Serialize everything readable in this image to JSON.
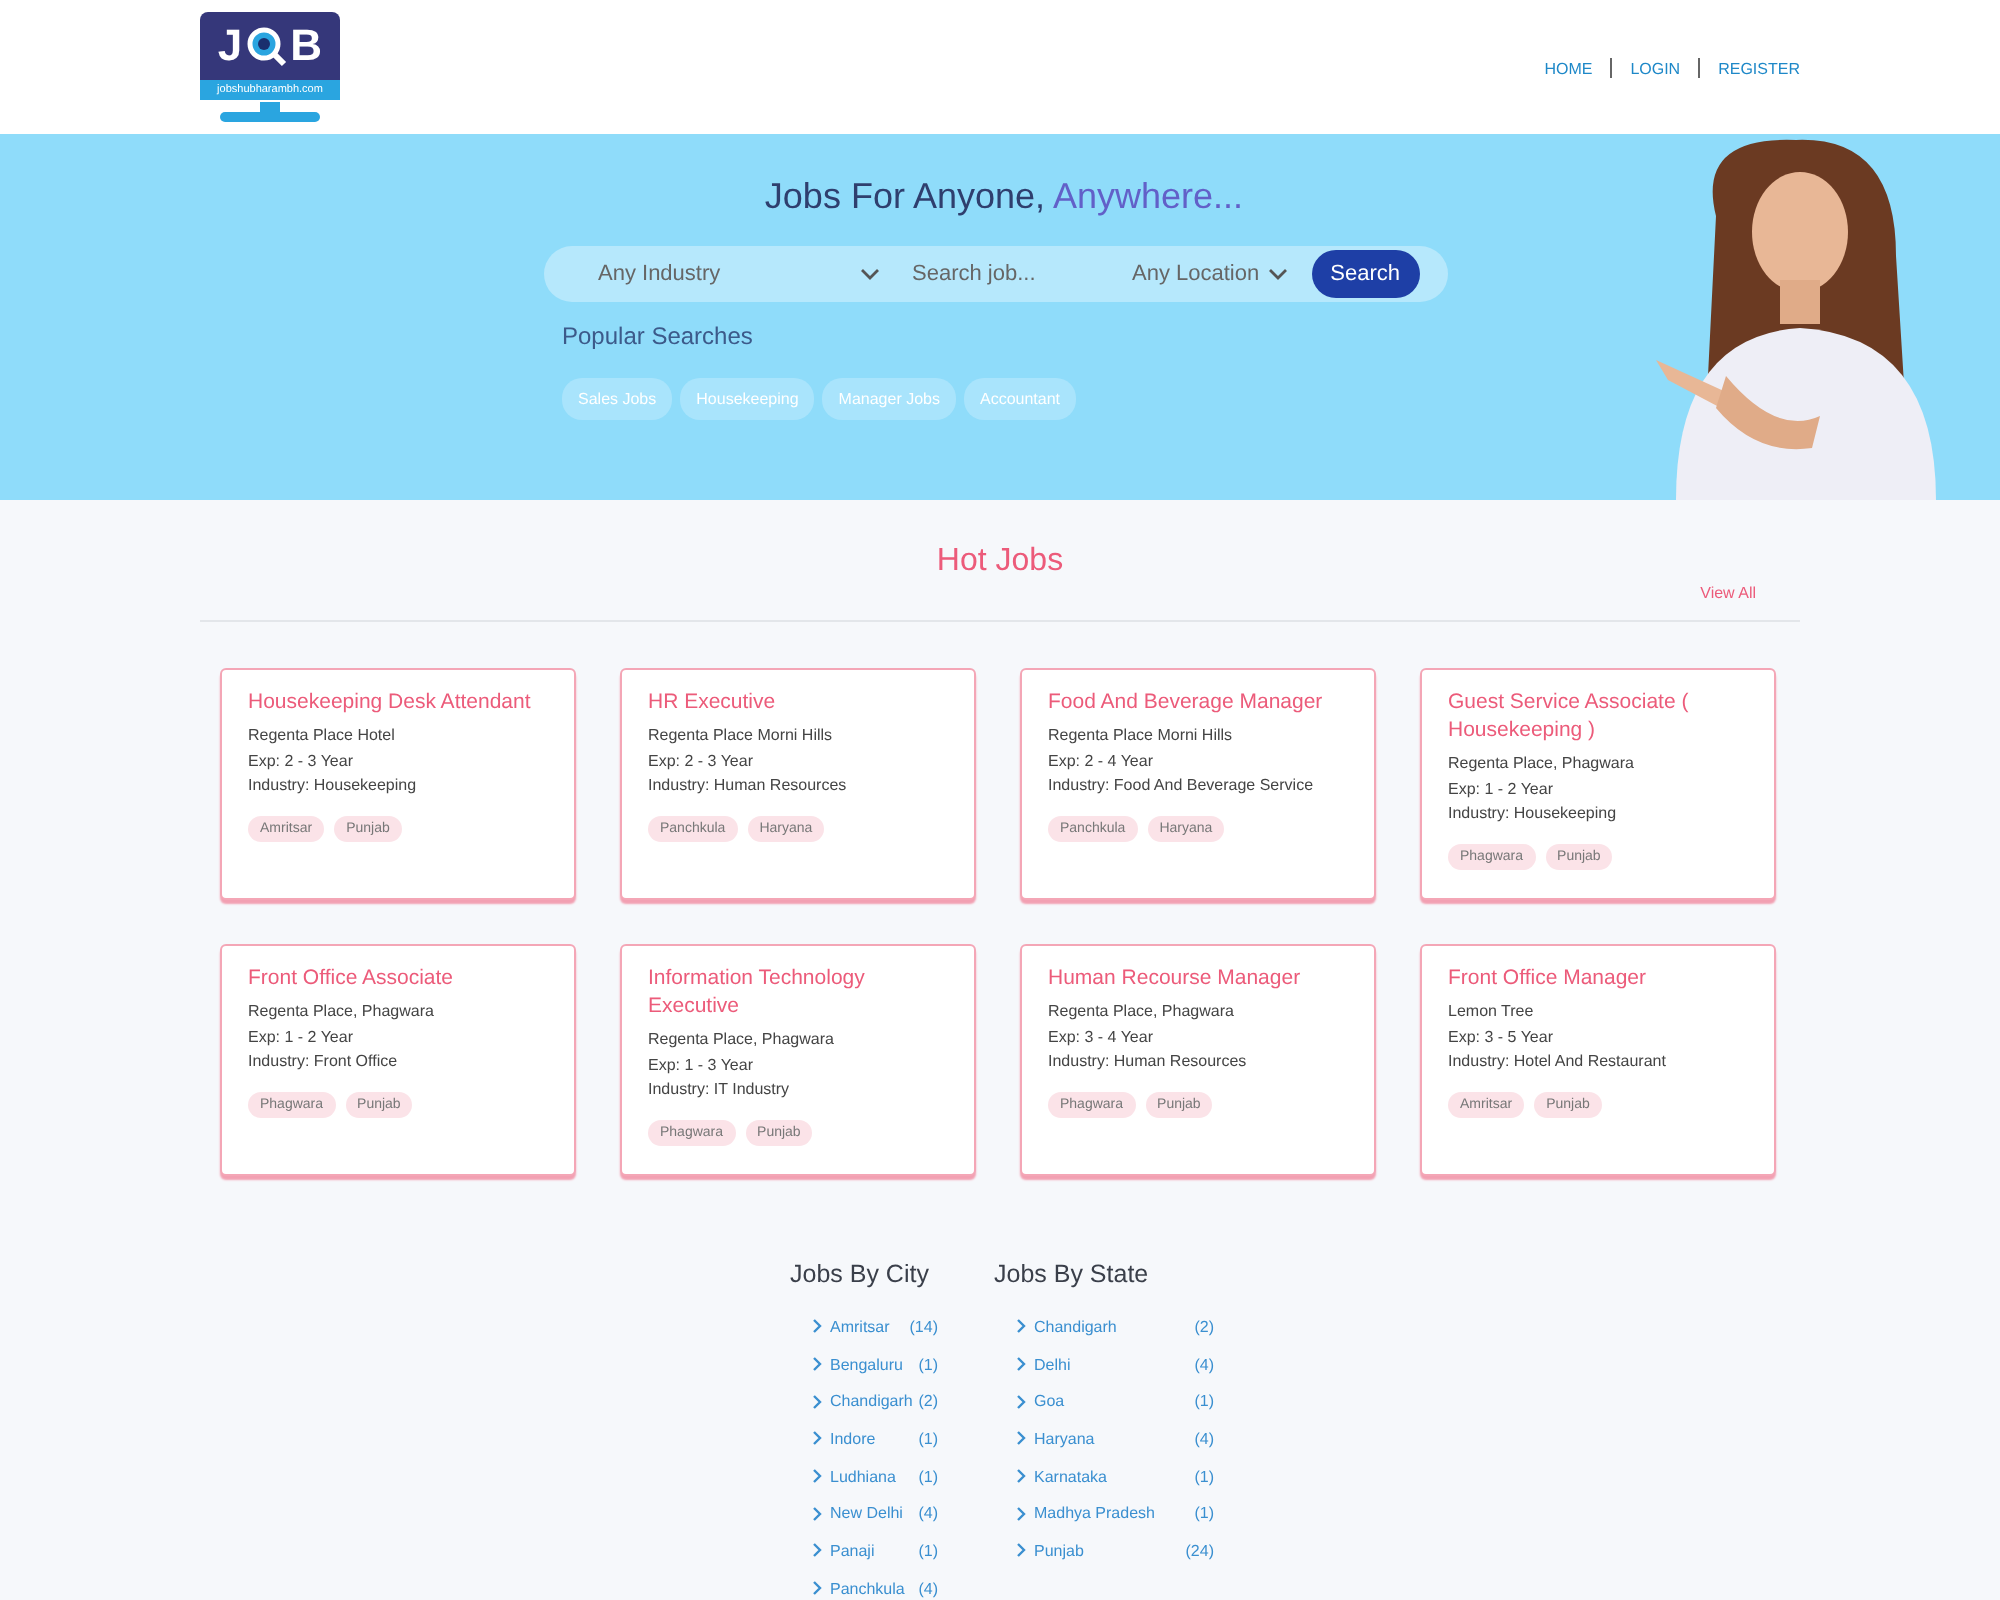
{
  "logo": {
    "letter_1": "J",
    "letter_2": "B",
    "domain": "jobshubharambh.com"
  },
  "nav": [
    "HOME",
    "LOGIN",
    "REGISTER"
  ],
  "hero": {
    "title": "Jobs For Anyone,",
    "title_accent": "Anywhere...",
    "industry_select": "Any Industry",
    "search": {
      "placeholder": "Search job..."
    },
    "location_select": "Any Location",
    "search_button": "Search",
    "popular_title": "Popular Searches",
    "popular": [
      "Sales Jobs",
      "Housekeeping",
      "Manager Jobs",
      "Accountant"
    ]
  },
  "hot_jobs": {
    "title": "Hot Jobs",
    "view_all": "View All",
    "jobs": [
      {
        "title": "Housekeeping Desk Attendant",
        "company": "Regenta Place Hotel",
        "exp": "Exp: 2 - 3 Year",
        "industry": "Industry: Housekeeping",
        "tags": [
          "Amritsar",
          "Punjab"
        ]
      },
      {
        "title": "HR Executive",
        "company": "Regenta Place Morni Hills",
        "exp": "Exp: 2 - 3 Year",
        "industry": "Industry: Human Resources",
        "tags": [
          "Panchkula",
          "Haryana"
        ]
      },
      {
        "title": "Food And Beverage Manager",
        "company": "Regenta Place Morni Hills",
        "exp": "Exp: 2 - 4 Year",
        "industry": "Industry: Food And Beverage Service",
        "tags": [
          "Panchkula",
          "Haryana"
        ]
      },
      {
        "title": "Guest Service Associate ( Housekeeping )",
        "company": "Regenta Place, Phagwara",
        "exp": "Exp: 1 - 2 Year",
        "industry": "Industry: Housekeeping",
        "tags": [
          "Phagwara",
          "Punjab"
        ]
      },
      {
        "title": "Front Office Associate",
        "company": "Regenta Place, Phagwara",
        "exp": "Exp: 1 - 2 Year",
        "industry": "Industry: Front Office",
        "tags": [
          "Phagwara",
          "Punjab"
        ]
      },
      {
        "title": "Information Technology Executive",
        "company": "Regenta Place, Phagwara",
        "exp": "Exp: 1 - 3 Year",
        "industry": "Industry: IT Industry",
        "tags": [
          "Phagwara",
          "Punjab"
        ]
      },
      {
        "title": "Human Recourse Manager",
        "company": "Regenta Place, Phagwara",
        "exp": "Exp: 3 - 4 Year",
        "industry": "Industry: Human Resources",
        "tags": [
          "Phagwara",
          "Punjab"
        ]
      },
      {
        "title": "Front Office Manager",
        "company": "Lemon Tree",
        "exp": "Exp: 3 - 5 Year",
        "industry": "Industry: Hotel And Restaurant",
        "tags": [
          "Amritsar",
          "Punjab"
        ]
      }
    ]
  },
  "by_city": {
    "title": "Jobs By City",
    "items": [
      {
        "name": "Amritsar",
        "count": "(14)"
      },
      {
        "name": "Bengaluru",
        "count": "(1)"
      },
      {
        "name": "Chandigarh",
        "count": "(2)"
      },
      {
        "name": "Indore",
        "count": "(1)"
      },
      {
        "name": "Ludhiana",
        "count": "(1)"
      },
      {
        "name": "New Delhi",
        "count": "(4)"
      },
      {
        "name": "Panaji",
        "count": "(1)"
      },
      {
        "name": "Panchkula",
        "count": "(4)"
      }
    ]
  },
  "by_state": {
    "title": "Jobs By State",
    "items": [
      {
        "name": "Chandigarh",
        "count": "(2)"
      },
      {
        "name": "Delhi",
        "count": "(4)"
      },
      {
        "name": "Goa",
        "count": "(1)"
      },
      {
        "name": "Haryana",
        "count": "(4)"
      },
      {
        "name": "Karnataka",
        "count": "(1)"
      },
      {
        "name": "Madhya Pradesh",
        "count": "(1)"
      },
      {
        "name": "Punjab",
        "count": "(24)"
      }
    ]
  }
}
